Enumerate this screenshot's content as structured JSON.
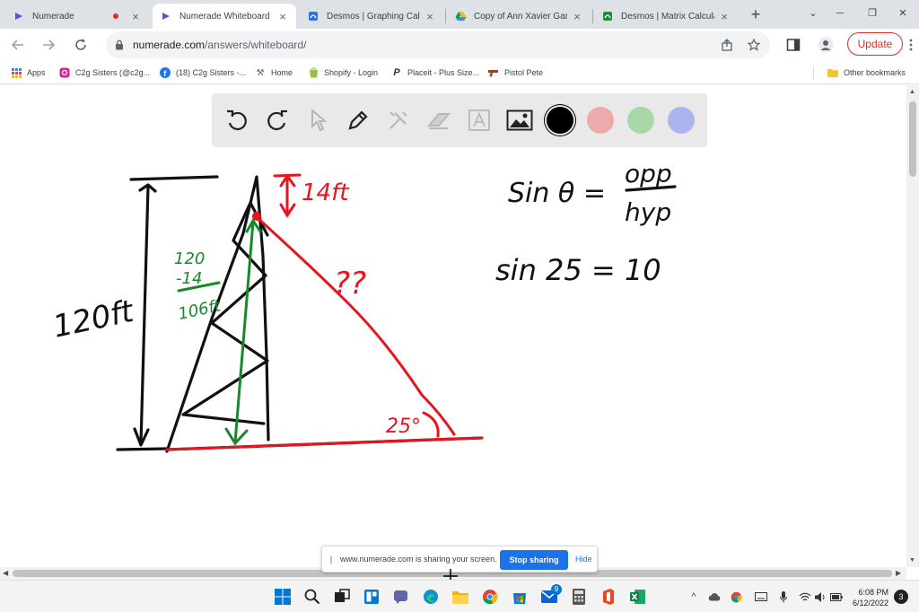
{
  "browser": {
    "tabs": [
      {
        "title": "Numerade",
        "active": false,
        "recording": true
      },
      {
        "title": "Numerade Whiteboard",
        "active": true,
        "recording": false
      },
      {
        "title": "Desmos | Graphing Calculator",
        "active": false,
        "recording": false
      },
      {
        "title": "Copy of Ann Xavier Gantert",
        "active": false,
        "recording": false
      },
      {
        "title": "Desmos | Matrix Calculator",
        "active": false,
        "recording": false
      }
    ],
    "url_domain": "numerade.com",
    "url_path": "/answers/whiteboard/",
    "update_label": "Update"
  },
  "bookmarks": {
    "items": [
      {
        "label": "Apps",
        "icon": "apps-grid-icon"
      },
      {
        "label": "C2g Sisters (@c2g...",
        "icon": "instagram-icon"
      },
      {
        "label": "(18) C2g Sisters -...",
        "icon": "facebook-icon"
      },
      {
        "label": "Home",
        "icon": "home-icon"
      },
      {
        "label": "Shopify - Login",
        "icon": "shopify-icon"
      },
      {
        "label": "Placeit - Plus Size...",
        "icon": "placeit-icon"
      },
      {
        "label": "Pistol Pete",
        "icon": "pistol-icon"
      }
    ],
    "other": "Other bookmarks"
  },
  "whiteboard": {
    "tools": [
      "undo-icon",
      "redo-icon",
      "select-icon",
      "pen-icon",
      "tools-icon",
      "eraser-icon",
      "text-icon",
      "image-icon"
    ],
    "colors": [
      "#000000",
      "#eeaaaa",
      "#a8d8a8",
      "#aab4ee"
    ],
    "selected_color": "#000000",
    "drawing_colors": {
      "black": "#111111",
      "red": "#e8141e",
      "green": "#168a2a"
    },
    "annotations": {
      "height_total": "120ft",
      "top_gap": "14ft",
      "hypotenuse": "??",
      "angle": "25°",
      "calc_top": "120",
      "calc_sub": "-14",
      "calc_result": "106ft",
      "formula_lhs": "Sin θ =",
      "formula_num": "opp",
      "formula_den": "hyp",
      "equation": "sin 25 = 10"
    }
  },
  "share_banner": {
    "message": "www.numerade.com is sharing your screen.",
    "stop": "Stop sharing",
    "hide": "Hide"
  },
  "taskbar": {
    "time": "6:08 PM",
    "date": "6/12/2022",
    "notifications": "3",
    "mail_badge": "9"
  }
}
